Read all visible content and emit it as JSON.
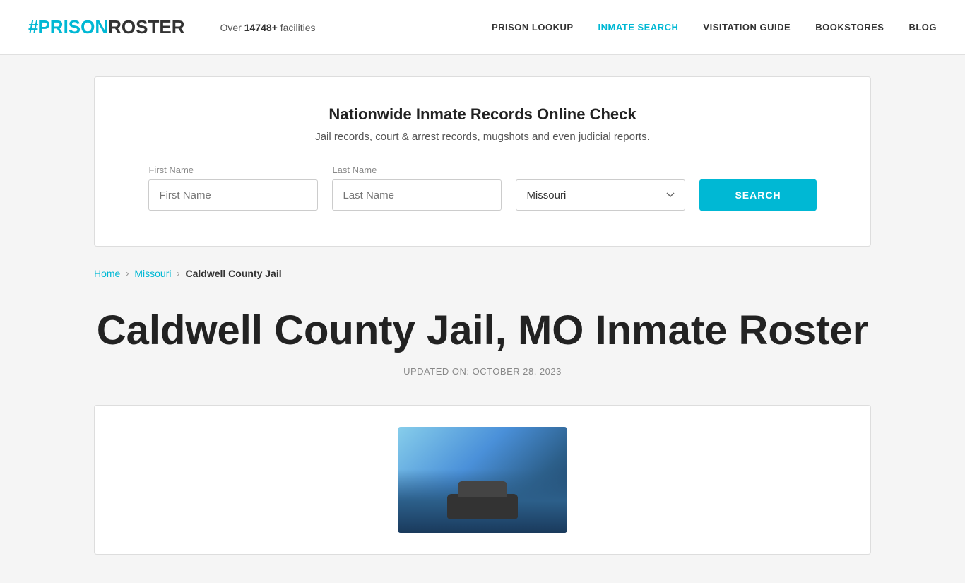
{
  "header": {
    "logo": {
      "hash": "#",
      "prison": "PRISON",
      "roster": "ROSTER"
    },
    "facilities_prefix": "Over ",
    "facilities_count": "14748+",
    "facilities_suffix": " facilities",
    "nav": {
      "items": [
        {
          "id": "prison-lookup",
          "label": "PRISON LOOKUP",
          "active": false
        },
        {
          "id": "inmate-search",
          "label": "INMATE SEARCH",
          "active": true
        },
        {
          "id": "visitation-guide",
          "label": "VISITATION GUIDE",
          "active": false
        },
        {
          "id": "bookstores",
          "label": "BOOKSTORES",
          "active": false
        },
        {
          "id": "blog",
          "label": "BLOG",
          "active": false
        }
      ]
    }
  },
  "search_card": {
    "title": "Nationwide Inmate Records Online Check",
    "subtitle": "Jail records, court & arrest records, mugshots and even judicial reports.",
    "first_name_label": "First Name",
    "last_name_label": "Last Name",
    "state_default": "Missouri",
    "search_button": "SEARCH"
  },
  "breadcrumb": {
    "home": "Home",
    "state": "Missouri",
    "current": "Caldwell County Jail"
  },
  "page_title": {
    "heading": "Caldwell County Jail, MO Inmate Roster",
    "updated_label": "UPDATED ON: OCTOBER 28, 2023"
  }
}
